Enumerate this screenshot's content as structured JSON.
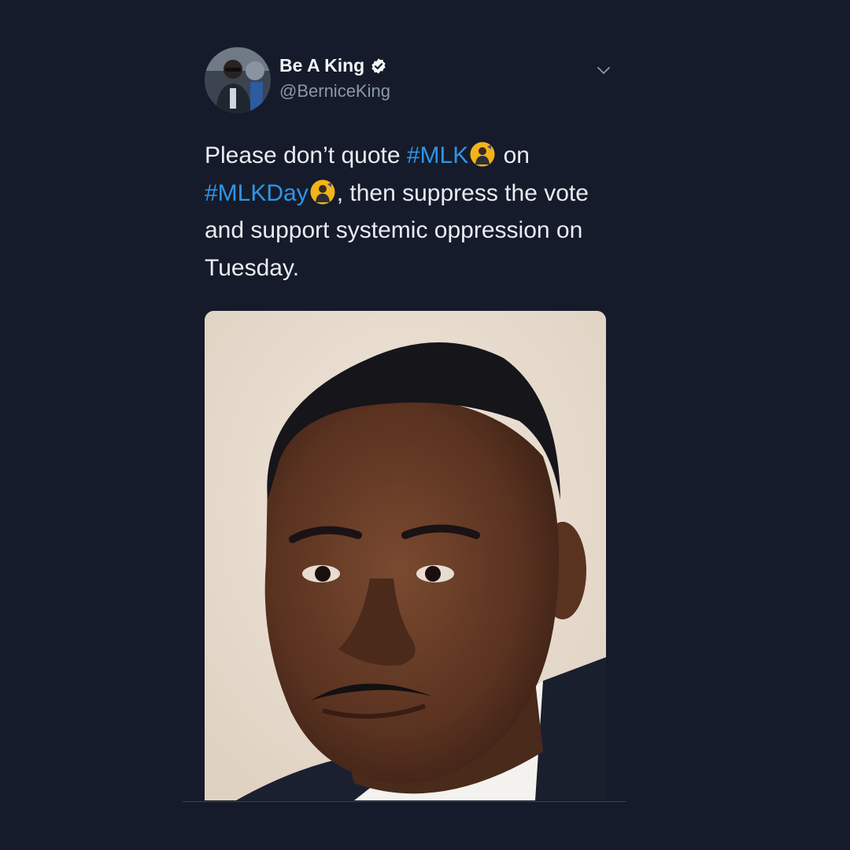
{
  "author": {
    "display_name": "Be A King",
    "handle": "@BerniceKing",
    "verified": true,
    "avatar_icon": "profile-photo"
  },
  "menu_icon": "chevron-down-icon",
  "tweet": {
    "text_parts": {
      "p1": "Please don’t quote ",
      "tag1": "#MLK",
      "p2": " on",
      "tag2": "#MLKDay",
      "p3": ", then suppress the vote and support systemic oppression on Tuesday."
    },
    "hashtag_emoji_icon": "mlk-hashtag-emoji"
  },
  "media": {
    "type": "photo",
    "subject": "portrait photograph"
  },
  "colors": {
    "background": "#151b2a",
    "text": "#e9ecf1",
    "hashtag": "#2f95e6",
    "secondary_text": "#8b98a8",
    "emoji_badge": "#f2b31b"
  }
}
